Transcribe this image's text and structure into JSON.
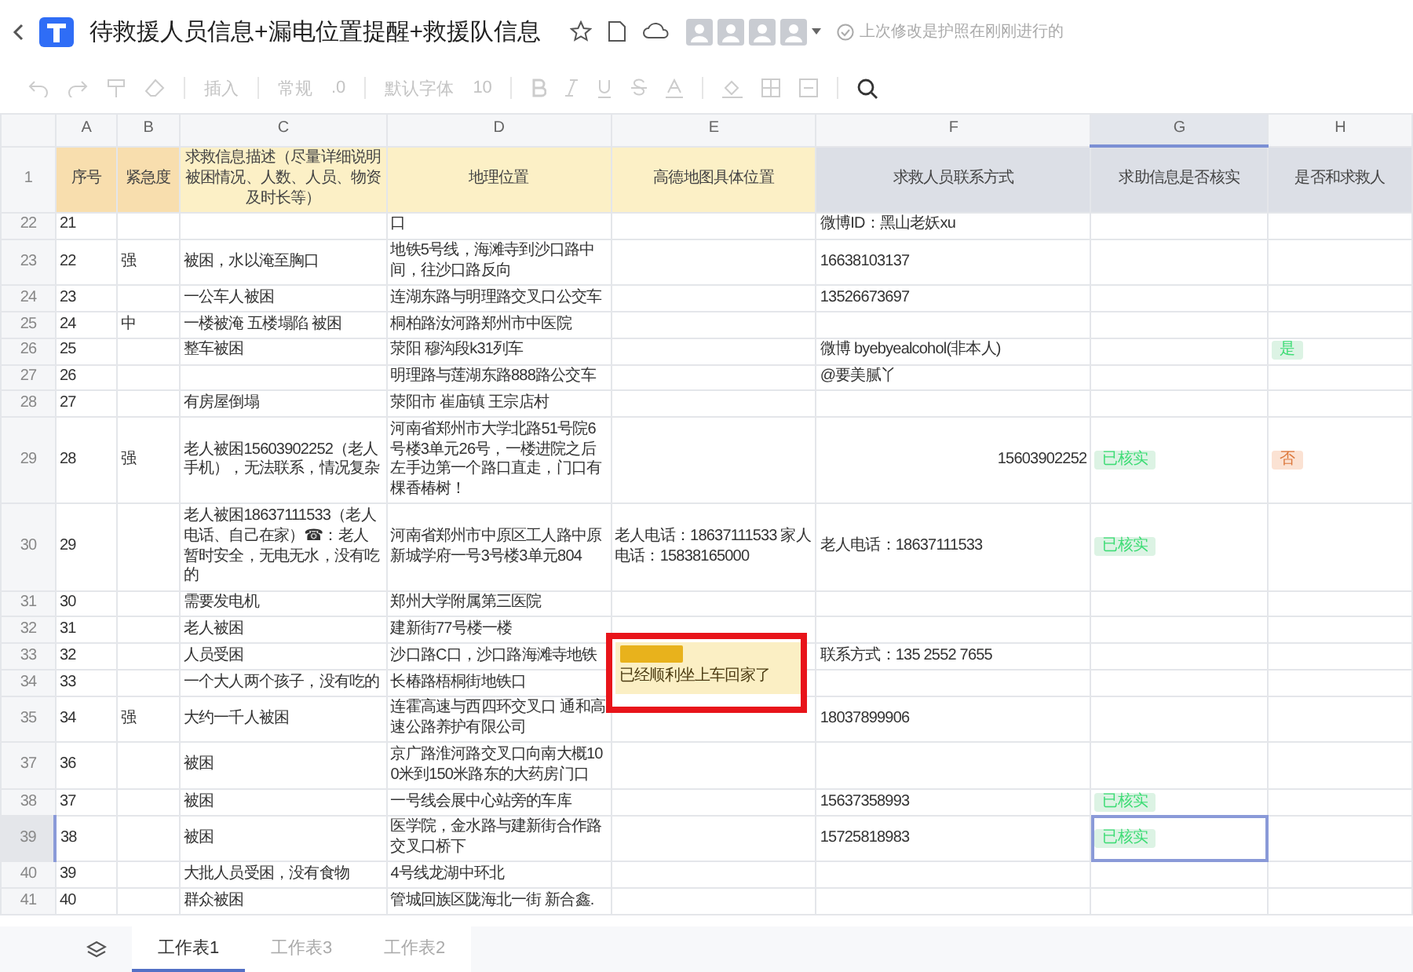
{
  "window": {
    "title": "待救援人员信息+漏电位置提醒+救援队信息",
    "save_status": "上次修改是护照在刚刚进行的"
  },
  "toolbar": {
    "insert": "插入",
    "format": "常规",
    "decimal": ".0",
    "font": "默认字体",
    "size": "10"
  },
  "table": {
    "columns": [
      {
        "letter": "A",
        "selected": false
      },
      {
        "letter": "B",
        "selected": false
      },
      {
        "letter": "C",
        "selected": false
      },
      {
        "letter": "D",
        "selected": false
      },
      {
        "letter": "E",
        "selected": false
      },
      {
        "letter": "F",
        "selected": false
      },
      {
        "letter": "G",
        "selected": true
      },
      {
        "letter": "H",
        "selected": false
      }
    ],
    "header_row": {
      "num": "1",
      "cells": [
        {
          "text": "序号",
          "color": "#f8deae"
        },
        {
          "text": "紧急度",
          "color": "#f8deae"
        },
        {
          "text": "求救信息描述（尽量详细说明被困情况、人数、人员、物资及时长等）",
          "color": "#fcf0c6"
        },
        {
          "text": "地理位置",
          "color": "#fcf0c6"
        },
        {
          "text": "高德地图具体位置",
          "color": "#fcf0c6"
        },
        {
          "text": "求救人员联系方式",
          "color": "#dcdfe6"
        },
        {
          "text": "求助信息是否核实",
          "color": "#dcdfe6"
        },
        {
          "text": "是否和求救人",
          "color": "#dcdfe6"
        }
      ]
    },
    "rows": [
      {
        "num": "22",
        "selected": false,
        "cells": [
          "21",
          "",
          "",
          "口",
          "",
          "微博ID：黑山老妖xu",
          "",
          ""
        ]
      },
      {
        "num": "23",
        "selected": false,
        "cells": [
          "22",
          "强",
          "被困，水以淹至胸口",
          "地铁5号线，海滩寺到沙口路中间，往沙口路反向",
          "",
          "16638103137",
          "",
          ""
        ]
      },
      {
        "num": "24",
        "selected": false,
        "cells": [
          "23",
          "",
          "一公车人被困",
          "连湖东路与明理路交叉口公交车",
          "",
          "13526673697",
          "",
          ""
        ]
      },
      {
        "num": "25",
        "selected": false,
        "cells": [
          "24",
          "中",
          "一楼被淹 五楼塌陷 被困",
          "桐柏路汝河路郑州市中医院",
          "",
          "",
          "",
          ""
        ]
      },
      {
        "num": "26",
        "selected": false,
        "cells": [
          "25",
          "",
          "整车被困",
          "荥阳 穆沟段k31列车",
          "",
          "微博  byebyealcohol(非本人)",
          "",
          {
            "tag": "是",
            "color": "#dcf3e4"
          }
        ]
      },
      {
        "num": "27",
        "selected": false,
        "cells": [
          "26",
          "",
          "",
          "明理路与莲湖东路888路公交车",
          "",
          "@要美腻丫",
          "",
          ""
        ]
      },
      {
        "num": "28",
        "selected": false,
        "cells": [
          "27",
          "",
          "有房屋倒塌",
          "荥阳市 崔庙镇 王宗店村",
          "",
          "",
          "",
          ""
        ]
      },
      {
        "num": "29",
        "selected": false,
        "cells": [
          "28",
          "强",
          "老人被困15603902252（老人手机），无法联系，情况复杂",
          "河南省郑州市大学北路51号院6号楼3单元26号，一楼进院之后左手边第一个路口直走，门口有棵香椿树！",
          "",
          {
            "text": "15603902252",
            "numeric": true
          },
          {
            "tag": "已核实",
            "color": "#dcf3e4"
          },
          {
            "tag": "否",
            "color": "#fbe2d3"
          }
        ]
      },
      {
        "num": "30",
        "selected": false,
        "cells": [
          "29",
          "",
          "老人被困18637111533（老人电话、自己在家）☎：老人暂时安全，无电无水，没有吃的",
          "河南省郑州市中原区工人路中原新城学府一号3号楼3单元804",
          "老人电话：18637111533 家人电话：15838165000",
          "老人电话：18637111533",
          {
            "tag": "已核实",
            "color": "#dcf3e4"
          },
          ""
        ]
      },
      {
        "num": "31",
        "selected": false,
        "cells": [
          "30",
          "",
          "需要发电机",
          "郑州大学附属第三医院",
          "",
          "",
          "",
          ""
        ]
      },
      {
        "num": "32",
        "selected": false,
        "cells": [
          "31",
          "",
          "老人被困",
          "建新街77号楼一楼",
          "",
          "",
          "",
          ""
        ]
      },
      {
        "num": "33",
        "selected": false,
        "cells": [
          "32",
          "",
          "人员受困",
          "沙口路C口，沙口路海滩寺地铁",
          "",
          "联系方式：135 2552 7655",
          "",
          ""
        ]
      },
      {
        "num": "34",
        "selected": false,
        "cells": [
          "33",
          "",
          "一个大人两个孩子，没有吃的",
          "长椿路梧桐街地铁口",
          {
            "note": "已经顺利坐上车回家了",
            "tagged": true
          },
          "",
          "",
          ""
        ]
      },
      {
        "num": "35",
        "selected": false,
        "cells": [
          "34",
          "强",
          "大约一千人被困",
          "连霍高速与西四环交叉口 通和高速公路养护有限公司",
          "",
          "18037899906",
          "",
          ""
        ]
      },
      {
        "num": "37",
        "selected": false,
        "cells": [
          "36",
          "",
          "被困",
          "京广路淮河路交叉口向南大概100米到150米路东的大药房门口",
          "",
          "",
          "",
          ""
        ]
      },
      {
        "num": "38",
        "selected": false,
        "cells": [
          "37",
          "",
          "被困",
          "一号线会展中心站旁的车库",
          "",
          "15637358993",
          {
            "tag": "已核实",
            "color": "#dcf3e4"
          },
          ""
        ]
      },
      {
        "num": "39",
        "selected": true,
        "cells": [
          "38",
          "",
          "被困",
          "医学院，金水路与建新街合作路交叉口桥下",
          "",
          "15725818983",
          {
            "tag": "已核实",
            "color": "#dcf3e4"
          },
          ""
        ]
      },
      {
        "num": "40",
        "selected": false,
        "cells": [
          "39",
          "",
          "大批人员受困，没有食物",
          "4号线龙湖中环北",
          "",
          "",
          "",
          ""
        ]
      },
      {
        "num": "41",
        "selected": false,
        "cells": [
          "40",
          "",
          "群众被困",
          "管城回族区陇海北一街 新合鑫.",
          "",
          "",
          "",
          ""
        ]
      }
    ]
  },
  "sheet_tabs": [
    {
      "label": "工作表1",
      "selected": true
    },
    {
      "label": "工作表3",
      "selected": false
    },
    {
      "label": "工作表2",
      "selected": false
    }
  ]
}
